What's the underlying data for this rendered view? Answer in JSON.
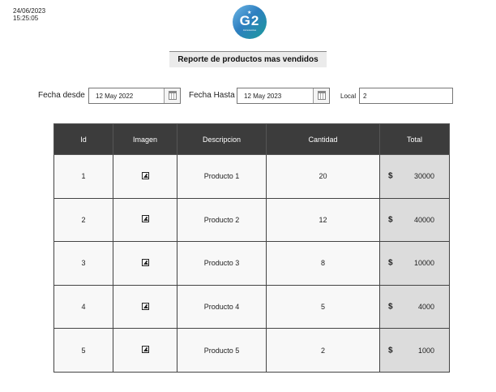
{
  "timestamp": {
    "date": "24/06/2023",
    "time": "15:25:05"
  },
  "logo": {
    "text": "G2",
    "subtitle": "Accessories",
    "icon": "star-icon"
  },
  "report": {
    "title": "Reporte de productos mas vendidos"
  },
  "filters": {
    "fecha_desde_label": "Fecha desde",
    "fecha_desde_value": "12 May 2022",
    "fecha_hasta_label": "Fecha Hasta",
    "fecha_hasta_value": "12 May 2023",
    "local_label": "Local",
    "local_value": "2"
  },
  "table": {
    "headers": [
      "Id",
      "Imagen",
      "Descripcion",
      "Cantidad",
      "Total"
    ],
    "currency_symbol": "$",
    "rows": [
      {
        "id": "1",
        "image_icon": "image-icon",
        "descripcion": "Producto 1",
        "cantidad": "20",
        "total": "30000"
      },
      {
        "id": "2",
        "image_icon": "image-icon",
        "descripcion": "Producto 2",
        "cantidad": "12",
        "total": "40000"
      },
      {
        "id": "3",
        "image_icon": "image-icon",
        "descripcion": "Producto 3",
        "cantidad": "8",
        "total": "10000"
      },
      {
        "id": "4",
        "image_icon": "image-icon",
        "descripcion": "Producto 4",
        "cantidad": "5",
        "total": "4000"
      },
      {
        "id": "5",
        "image_icon": "image-icon",
        "descripcion": "Producto 5",
        "cantidad": "2",
        "total": "1000"
      }
    ]
  }
}
